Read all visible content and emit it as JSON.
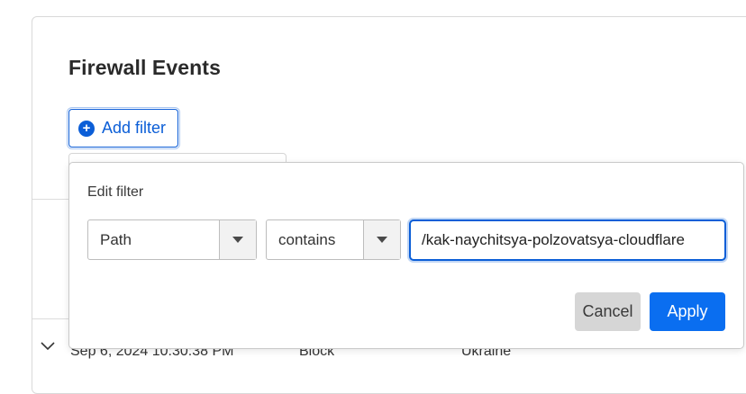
{
  "page": {
    "title": "Firewall Events"
  },
  "toolbar": {
    "add_filter_label": "Add filter",
    "add_filter_icon": "plus-circle-icon"
  },
  "background_row": {
    "expand_icon": "chevron-down-icon",
    "date": "Sep 6, 2024 10:30:38 PM",
    "action": "Block",
    "country": "Ukraine"
  },
  "edit_filter": {
    "title": "Edit filter",
    "field": {
      "selected": "Path"
    },
    "operator": {
      "selected": "contains"
    },
    "value": "/kak-naychitsya-polzovatsya-cloudflare",
    "cancel_label": "Cancel",
    "apply_label": "Apply"
  },
  "colors": {
    "accent": "#0b5ed7",
    "apply_bg": "#0a6ef0",
    "cancel_bg": "#d6d6d6"
  }
}
